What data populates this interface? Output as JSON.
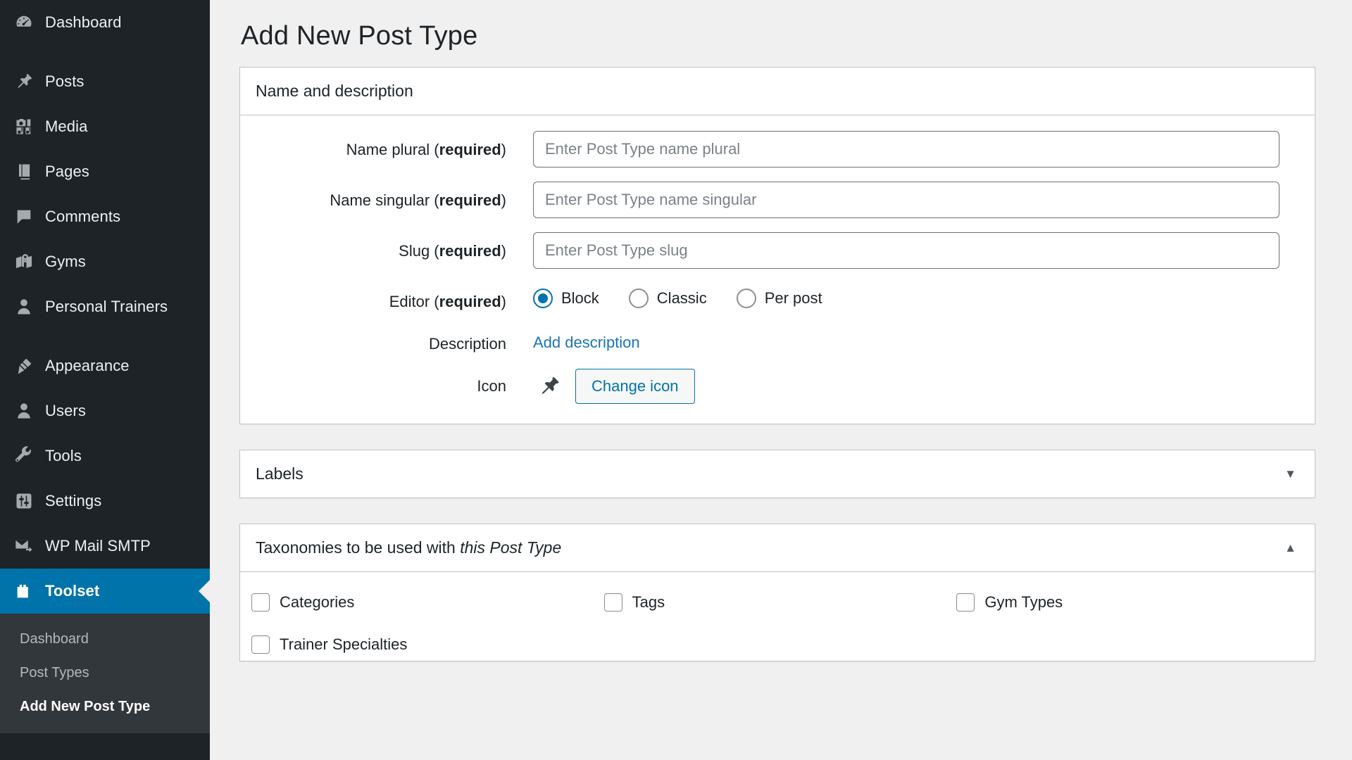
{
  "sidebar": {
    "items": [
      {
        "label": "Dashboard",
        "icon": "dashboard-gauge-icon",
        "current": false,
        "gap": false
      },
      {
        "label": "Posts",
        "icon": "pin-icon",
        "current": false,
        "gap": true
      },
      {
        "label": "Media",
        "icon": "media-camera-note-icon",
        "current": false,
        "gap": false
      },
      {
        "label": "Pages",
        "icon": "pages-icon",
        "current": false,
        "gap": false
      },
      {
        "label": "Comments",
        "icon": "comment-bubble-icon",
        "current": false,
        "gap": false
      },
      {
        "label": "Gyms",
        "icon": "map-marker-book-icon",
        "current": false,
        "gap": false
      },
      {
        "label": "Personal Trainers",
        "icon": "user-icon",
        "current": false,
        "gap": false
      },
      {
        "label": "Appearance",
        "icon": "paintbrush-icon",
        "current": false,
        "gap": true
      },
      {
        "label": "Users",
        "icon": "user-icon",
        "current": false,
        "gap": false
      },
      {
        "label": "Tools",
        "icon": "wrench-icon",
        "current": false,
        "gap": false
      },
      {
        "label": "Settings",
        "icon": "sliders-icon",
        "current": false,
        "gap": false
      },
      {
        "label": "WP Mail SMTP",
        "icon": "email-arrow-icon",
        "current": false,
        "gap": false
      },
      {
        "label": "Toolset",
        "icon": "toolset-block-icon",
        "current": true,
        "gap": false
      }
    ],
    "submenu": [
      {
        "label": "Dashboard",
        "current": false
      },
      {
        "label": "Post Types",
        "current": false
      },
      {
        "label": "Add New Post Type",
        "current": true
      }
    ],
    "colors": {
      "background": "#1d2327",
      "submenu_background": "#32373c",
      "current_highlight": "#0073aa",
      "label": "#f0f0f1",
      "submenu_label": "#b4b9be"
    }
  },
  "page": {
    "title": "Add New Post Type"
  },
  "name_panel": {
    "title": "Name and description",
    "fields": {
      "name_plural": {
        "label_text": "Name plural (",
        "label_required": "required",
        "label_tail": ")",
        "placeholder": "Enter Post Type name plural",
        "value": ""
      },
      "name_singular": {
        "label_text": "Name singular (",
        "label_required": "required",
        "label_tail": ")",
        "placeholder": "Enter Post Type name singular",
        "value": ""
      },
      "slug": {
        "label_text": "Slug (",
        "label_required": "required",
        "label_tail": ")",
        "placeholder": "Enter Post Type slug",
        "value": ""
      }
    },
    "editor": {
      "label_text": "Editor (",
      "label_required": "required",
      "label_tail": ")",
      "options": [
        {
          "label": "Block",
          "checked": true
        },
        {
          "label": "Classic",
          "checked": false
        },
        {
          "label": "Per post",
          "checked": false
        }
      ]
    },
    "description": {
      "label": "Description",
      "link_label": "Add description",
      "link_color": "#1b74b4"
    },
    "icon": {
      "label": "Icon",
      "preview_icon": "pin-icon",
      "button_label": "Change icon",
      "button_color": "#0073aa"
    }
  },
  "labels_panel": {
    "title": "Labels",
    "toggle_icon": "chevron-down-icon",
    "toggle_glyph": "▼",
    "expanded": false
  },
  "taxonomies_panel": {
    "title_lead": "Taxonomies to be used with ",
    "title_emphasis": "this Post Type",
    "toggle_icon": "chevron-up-icon",
    "toggle_glyph": "▲",
    "expanded": true,
    "items": [
      {
        "label": "Categories",
        "checked": false
      },
      {
        "label": "Tags",
        "checked": false
      },
      {
        "label": "Gym Types",
        "checked": false
      },
      {
        "label": "Trainer Specialties",
        "checked": false
      }
    ]
  }
}
